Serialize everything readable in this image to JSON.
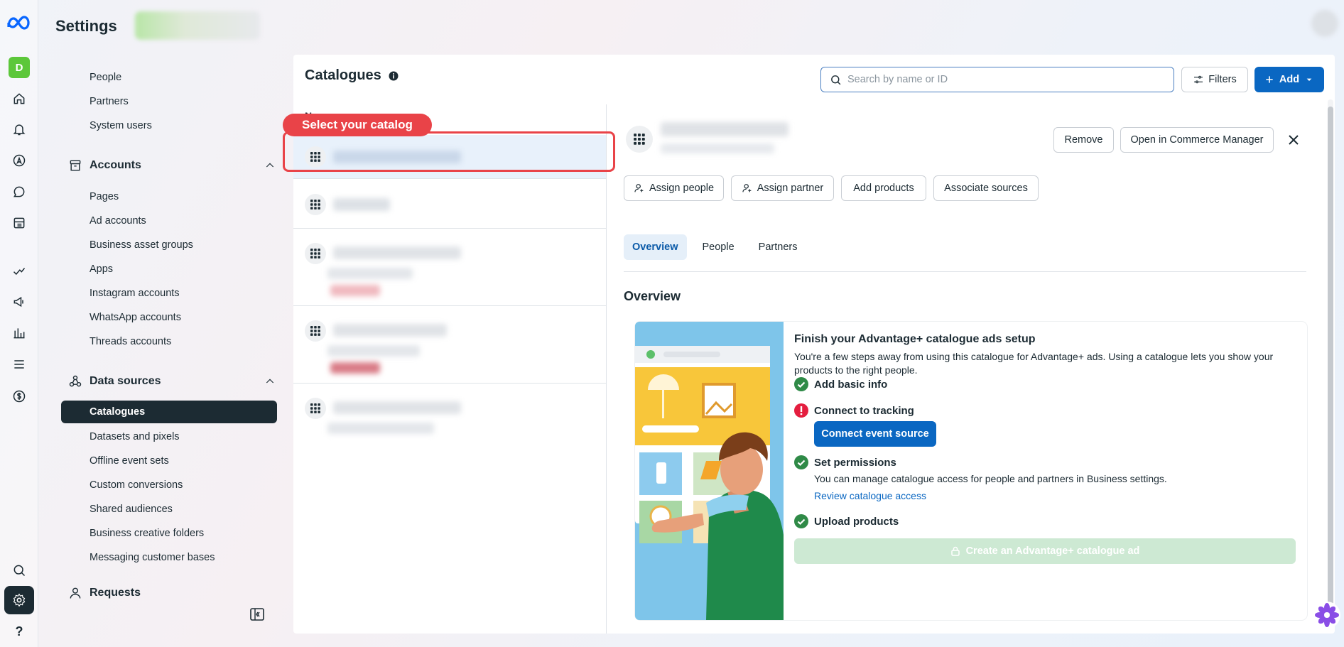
{
  "header": {
    "title": "Settings"
  },
  "rail": {
    "avatar_letter": "D",
    "help_label": "?"
  },
  "sidebar": {
    "top_items": [
      "People",
      "Partners",
      "System users"
    ],
    "accounts_group": {
      "label": "Accounts",
      "items": [
        "Pages",
        "Ad accounts",
        "Business asset groups",
        "Apps",
        "Instagram accounts",
        "WhatsApp accounts",
        "Threads accounts"
      ]
    },
    "data_sources_group": {
      "label": "Data sources",
      "active_item": "Catalogues",
      "items": [
        "Datasets and pixels",
        "Offline event sets",
        "Custom conversions",
        "Shared audiences",
        "Business creative folders",
        "Messaging customer bases"
      ]
    },
    "requests_group": {
      "label": "Requests"
    }
  },
  "panel": {
    "title": "Catalogues",
    "search": {
      "placeholder": "Search by name or ID"
    },
    "filters_label": "Filters",
    "add_label": "Add",
    "list_header": "Name"
  },
  "tooltip": {
    "label": "Select your catalog"
  },
  "detail": {
    "remove_label": "Remove",
    "open_label": "Open in Commerce Manager",
    "actions": [
      "Assign people",
      "Assign partner",
      "Add products",
      "Associate sources"
    ],
    "tabs": [
      "Overview",
      "People",
      "Partners"
    ],
    "overview_title": "Overview",
    "setup_title": "Finish your Advantage+ catalogue ads setup",
    "setup_desc": "You're a few steps away from using this catalogue for Advantage+ ads. Using a catalogue lets you show your products to the right people.",
    "steps": {
      "basic_info": "Add basic info",
      "tracking": "Connect to tracking",
      "tracking_button": "Connect event source",
      "permissions": "Set permissions",
      "permissions_desc": "You can manage catalogue access for people and partners in Business settings.",
      "permissions_link": "Review catalogue access",
      "upload": "Upload products"
    },
    "create_label": "Create an Advantage+ catalogue ad"
  },
  "colors": {
    "accent": "#0a67c2",
    "highlight": "#e94348",
    "success": "#31a24c",
    "error": "#e41e3f",
    "nav_active": "#1c2b33"
  }
}
